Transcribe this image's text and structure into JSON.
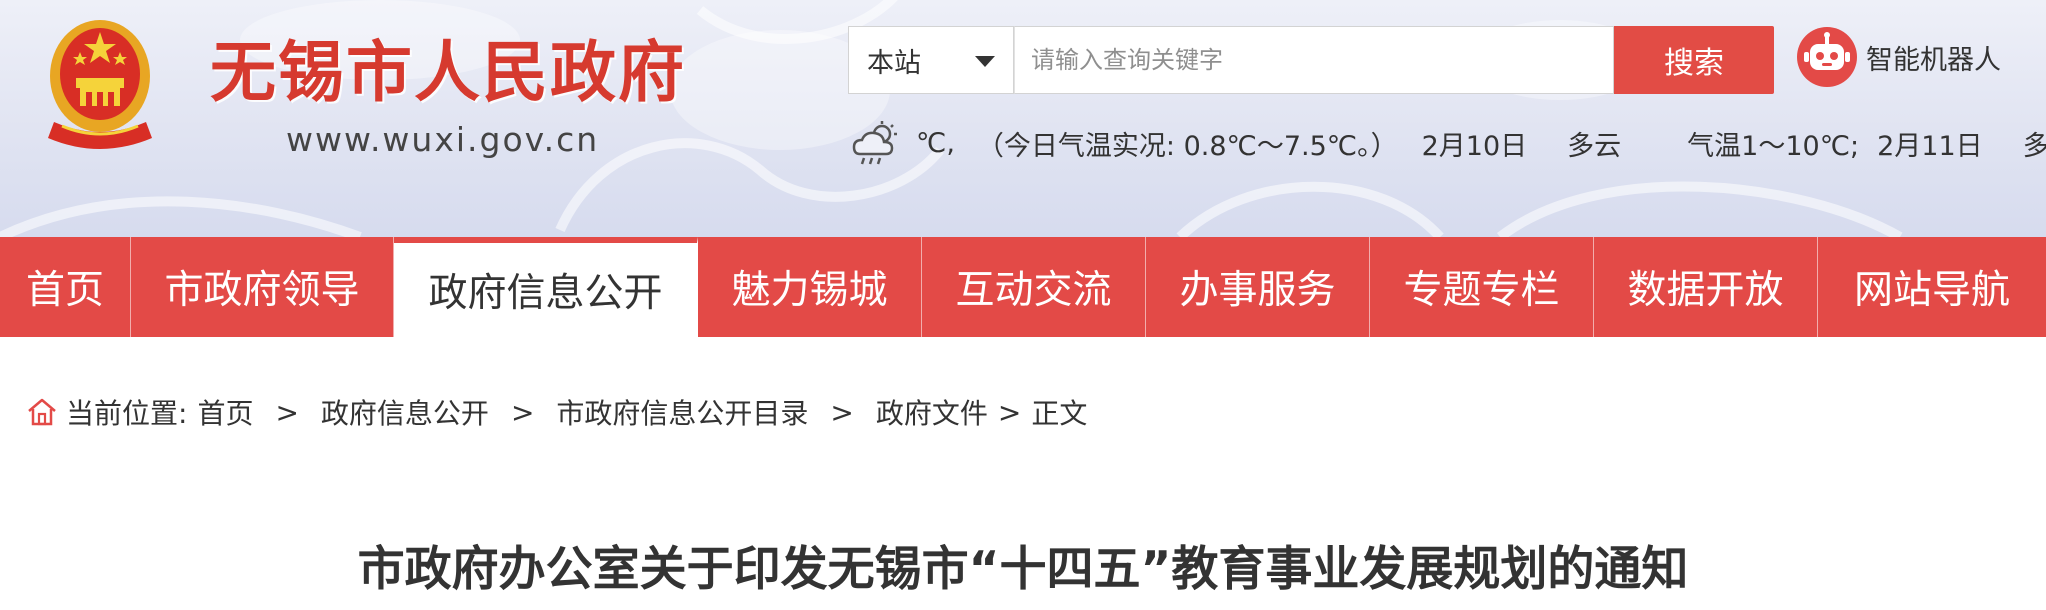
{
  "header": {
    "site_name": "无锡市人民政府",
    "site_url": "www.wuxi.gov.cn",
    "emblem_icon": "national-emblem-icon"
  },
  "search": {
    "scope_label": "本站",
    "placeholder": "请输入查询关键字",
    "button_label": "搜索"
  },
  "robot": {
    "icon": "robot-icon",
    "label": "智能机器人"
  },
  "weather": {
    "icon": "cloudy-weather-icon",
    "unit": "℃,",
    "today_label": "（今日气温实况: 0.8℃～7.5℃。）",
    "day1_date": "2月10日",
    "day1_desc": "多云",
    "day1_temp": "气温1～10℃;",
    "day2_date": "2月11日",
    "day2_desc": "多"
  },
  "nav": {
    "items": [
      {
        "label": "首页"
      },
      {
        "label": "市政府领导"
      },
      {
        "label": "政府信息公开"
      },
      {
        "label": "魅力锡城"
      },
      {
        "label": "互动交流"
      },
      {
        "label": "办事服务"
      },
      {
        "label": "专题专栏"
      },
      {
        "label": "数据开放"
      },
      {
        "label": "网站导航"
      }
    ],
    "active_index": 2
  },
  "breadcrumb": {
    "icon": "home-icon",
    "prefix": "当前位置:",
    "items": [
      "首页",
      "政府信息公开",
      "市政府信息公开目录",
      "政府文件",
      "正文"
    ],
    "separator": ">"
  },
  "article": {
    "title": "市政府办公室关于印发无锡市“十四五”教育事业发展规划的通知"
  },
  "colors": {
    "brand_red": "#e34a47",
    "title_red": "#d63a2f",
    "search_button": "#e24c45"
  }
}
